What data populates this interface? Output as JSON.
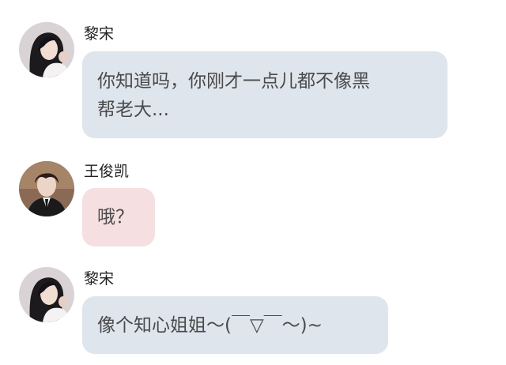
{
  "conversation": {
    "messages": [
      {
        "sender": "黎宋",
        "avatar_icon": "girl-portrait-avatar",
        "bubble_color": "#dfe5ed",
        "lines": [
          "你知道吗，你刚才一点儿都不像黑",
          "帮老大..."
        ]
      },
      {
        "sender": "王俊凯",
        "avatar_icon": "boy-portrait-avatar",
        "bubble_color": "#f5dfe0",
        "lines": [
          "哦？"
        ]
      },
      {
        "sender": "黎宋",
        "avatar_icon": "girl-portrait-avatar",
        "bubble_color": "#dfe5ed",
        "lines": [
          "像个知心姐姐～(￣▽￣～)~"
        ]
      }
    ]
  }
}
